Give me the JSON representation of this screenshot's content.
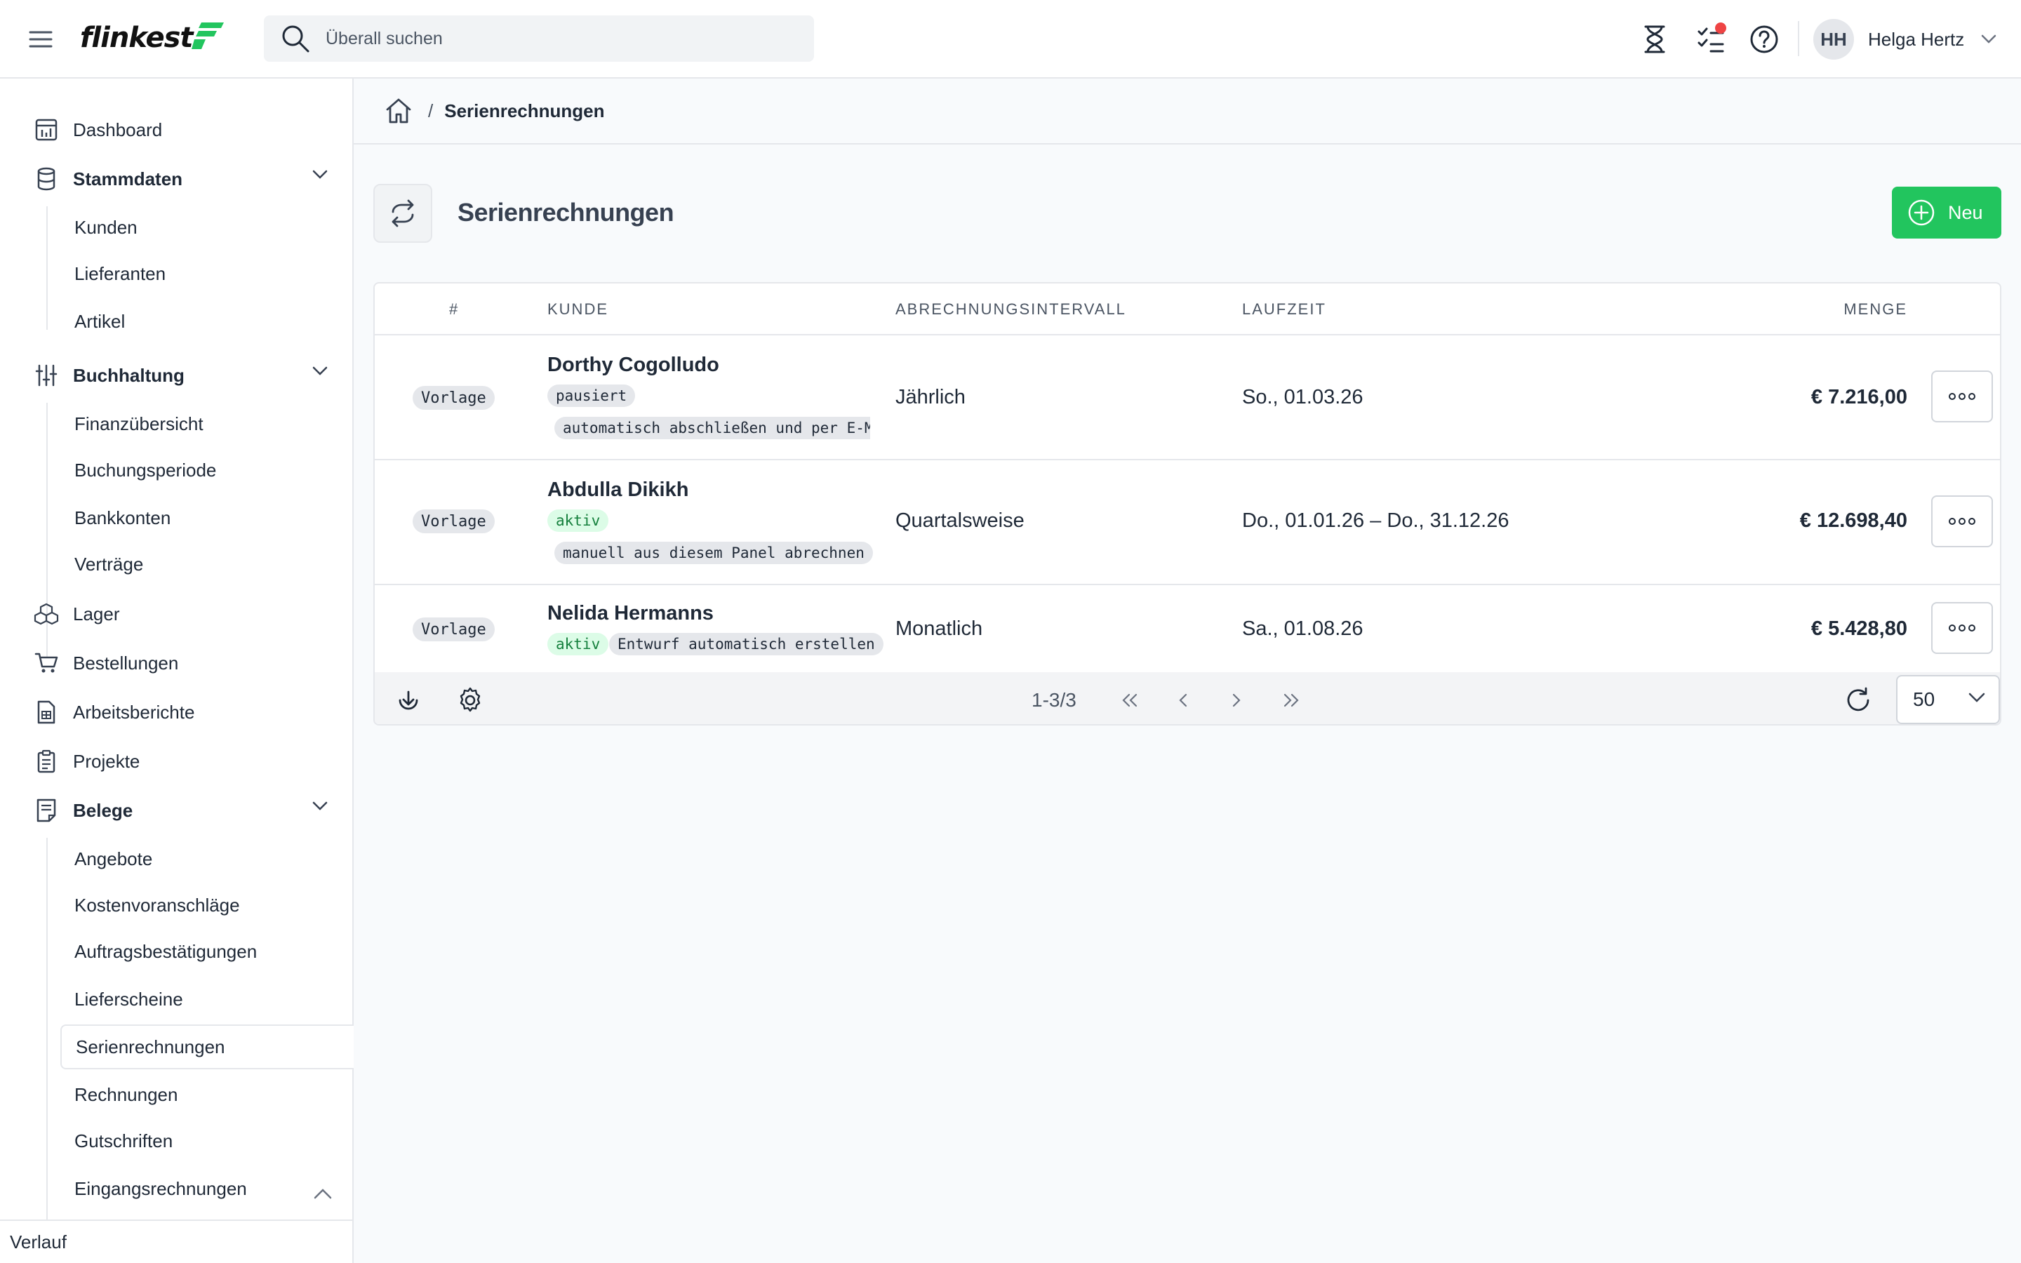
{
  "app": {
    "name": "flinkest"
  },
  "search": {
    "placeholder": "Überall suchen"
  },
  "user": {
    "initials": "HH",
    "name": "Helga Hertz"
  },
  "topbar": {
    "icons": [
      "menu-icon",
      "hourglass-icon",
      "task-list-icon",
      "help-icon",
      "chevron-down-icon"
    ]
  },
  "sidebar": {
    "dashboard": "Dashboard",
    "stammdaten": {
      "label": "Stammdaten",
      "items": [
        "Kunden",
        "Lieferanten",
        "Artikel"
      ]
    },
    "buchhaltung": {
      "label": "Buchhaltung",
      "items": [
        "Finanzübersicht",
        "Buchungsperiode",
        "Bankkonten",
        "Verträge"
      ]
    },
    "lager": "Lager",
    "bestellungen": "Bestellungen",
    "arbeitsberichte": "Arbeitsberichte",
    "projekte": "Projekte",
    "belege": {
      "label": "Belege",
      "items": [
        "Angebote",
        "Kostenvoranschläge",
        "Auftragsbestätigungen",
        "Lieferscheine",
        "Serienrechnungen",
        "Rechnungen",
        "Gutschriften",
        "Eingangsrechnungen"
      ],
      "active": "Serienrechnungen"
    },
    "verlauf": "Verlauf"
  },
  "breadcrumb": {
    "separator": "/",
    "current": "Serienrechnungen"
  },
  "page": {
    "title": "Serienrechnungen",
    "new_button": "Neu"
  },
  "table": {
    "columns": {
      "number": "#",
      "customer": "KUNDE",
      "interval": "ABRECHNUNGSINTERVALL",
      "term": "LAUFZEIT",
      "amount": "MENGE"
    },
    "rows": [
      {
        "tag": "Vorlage",
        "customer": "Dorthy Cogolludo",
        "status": "pausiert",
        "mode": "automatisch abschließen und per E-Mail",
        "interval": "Jährlich",
        "term": "So., 01.03.26",
        "amount": "€ 7.216,00"
      },
      {
        "tag": "Vorlage",
        "customer": "Abdulla Dikikh",
        "status": "aktiv",
        "mode": "manuell aus diesem Panel abrechnen",
        "interval": "Quartalsweise",
        "term": "Do., 01.01.26 – Do., 31.12.26",
        "amount": "€ 12.698,40"
      },
      {
        "tag": "Vorlage",
        "customer": "Nelida Hermanns",
        "status": "aktiv",
        "mode": "Entwurf automatisch erstellen",
        "interval": "Monatlich",
        "term": "Sa., 01.08.26",
        "amount": "€ 5.428,80"
      }
    ],
    "footer": {
      "range": "1-3/3",
      "per_page": "50"
    }
  },
  "colors": {
    "accent": "#22c55e",
    "status_active_bg": "#dcfce7",
    "status_active_text": "#15803d",
    "notification": "#ef4444"
  }
}
